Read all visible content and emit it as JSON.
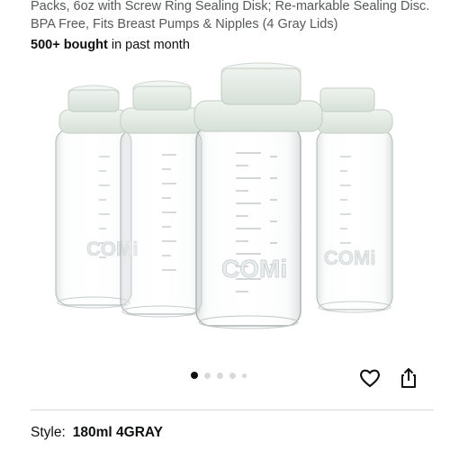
{
  "product": {
    "title": "Packs, 6oz with Screw Ring Sealing Disk; Re-markable Sealing Disc. BPA Free, Fits Breast Pumps & Nipples (4 Gray Lids)",
    "bought_count": "500+ bought",
    "bought_suffix": " in past month",
    "brand_mark": "COMi"
  },
  "gallery": {
    "dot_count": 5,
    "active_index": 0
  },
  "actions": {
    "favorite_icon": "heart-icon",
    "share_icon": "share-icon"
  },
  "variant": {
    "label": "Style:",
    "value": "180ml 4GRAY"
  },
  "colors": {
    "lid": "#e3ebe3",
    "text_secondary": "#565959"
  }
}
